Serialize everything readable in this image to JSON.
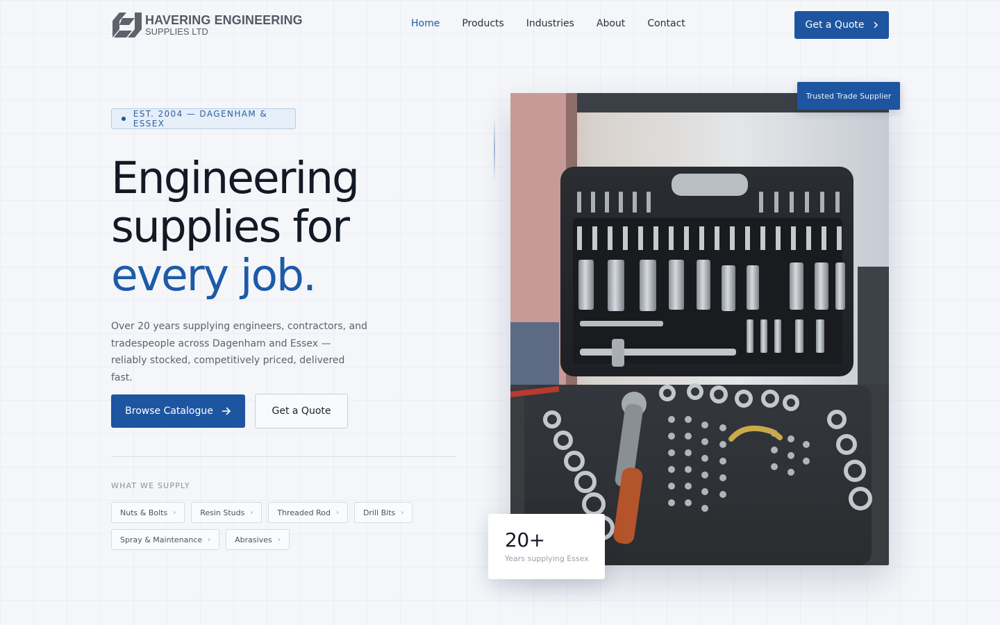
{
  "brand": {
    "name": "HAVERING ENGINEERING",
    "subtitle": "SUPPLIES LTD",
    "logo_icon": "stylised-h-icon",
    "color": "#555a63"
  },
  "nav": {
    "items": [
      {
        "label": "Home",
        "active": true
      },
      {
        "label": "Products",
        "active": false
      },
      {
        "label": "Industries",
        "active": false
      },
      {
        "label": "About",
        "active": false
      },
      {
        "label": "Contact",
        "active": false
      }
    ],
    "cta_label": "Get a Quote",
    "cta_icon": "chevron-right-icon"
  },
  "hero": {
    "badge": "EST. 2004 — DAGENHAM & ESSEX",
    "headline_line1": "Engineering",
    "headline_line2": "supplies for",
    "headline_line3": "every job.",
    "lede": "Over 20 years supplying engineers, contractors, and tradespeople across Dagenham and Essex — reliably stocked, competitively priced, delivered fast.",
    "primary_button": "Browse Catalogue",
    "primary_icon": "arrow-right-icon",
    "secondary_button": "Get a Quote",
    "supply_label": "WHAT WE SUPPLY",
    "categories": [
      "Nuts & Bolts",
      "Resin Studs",
      "Threaded Rod",
      "Drill Bits",
      "Spray & Maintenance",
      "Abrasives"
    ]
  },
  "media": {
    "image_subject": "open socket set toolbox",
    "trusted_badge": "Trusted Trade Supplier",
    "stat_value": "20+",
    "stat_label": "Years supplying Essex"
  },
  "colors": {
    "accent": "#1e55a0",
    "accent_text": "#1e5aa8",
    "background": "#f4f6f9",
    "heading": "#141926",
    "body_text": "#5b616c"
  }
}
